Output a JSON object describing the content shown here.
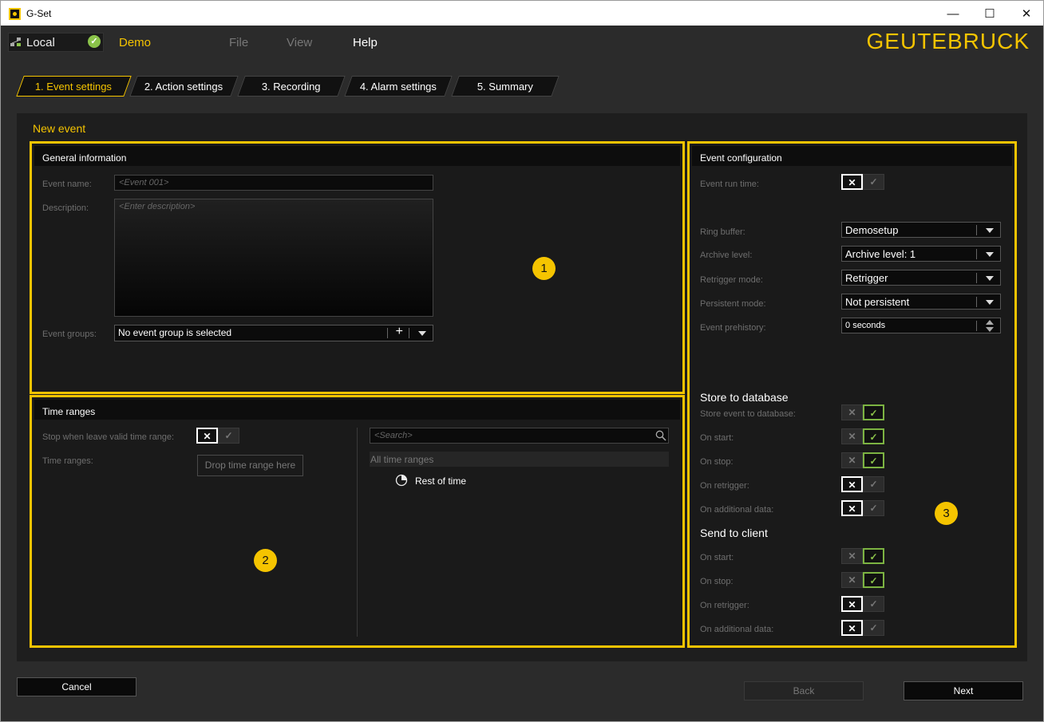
{
  "window": {
    "title": "G-Set",
    "min_icon": "minimize-icon",
    "max_icon": "maximize-icon",
    "close_icon": "close-icon"
  },
  "topbar": {
    "connection": "Local",
    "profile": "Demo",
    "menus": [
      "File",
      "View",
      "Help"
    ],
    "logo": "GEUTEBRUCK"
  },
  "wizard_tabs": [
    "1. Event settings",
    "2. Action settings",
    "3. Recording",
    "4. Alarm settings",
    "5. Summary"
  ],
  "page_title": "New event",
  "general": {
    "header": "General information",
    "event_name_label": "Event name:",
    "event_name_placeholder": "<Event 001>",
    "description_label": "Description:",
    "description_placeholder": "<Enter description>",
    "event_groups_label": "Event groups:",
    "event_groups_value": "No event group is selected"
  },
  "time_ranges": {
    "header": "Time ranges",
    "stop_label": "Stop when leave valid time range:",
    "ranges_label": "Time ranges:",
    "drop_text": "Drop time range here",
    "search_placeholder": "<Search>",
    "list_header": "All time ranges",
    "list_item": "Rest of time"
  },
  "event_config": {
    "header": "Event configuration",
    "run_time_label": "Event run time:",
    "ring_buffer_label": "Ring buffer:",
    "ring_buffer_value": "Demosetup",
    "archive_level_label": "Archive level:",
    "archive_level_value": "Archive level: 1",
    "retrigger_mode_label": "Retrigger mode:",
    "retrigger_mode_value": "Retrigger",
    "persistent_mode_label": "Persistent mode:",
    "persistent_mode_value": "Not persistent",
    "prehistory_label": "Event prehistory:",
    "prehistory_value": "0",
    "prehistory_unit": "seconds",
    "store_db_title": "Store to database",
    "store_db_items": [
      {
        "label": "Store event to database:",
        "state": "on"
      },
      {
        "label": "On start:",
        "state": "on"
      },
      {
        "label": "On stop:",
        "state": "on"
      },
      {
        "label": "On retrigger:",
        "state": "off"
      },
      {
        "label": "On additional data:",
        "state": "off"
      }
    ],
    "send_client_title": "Send to client",
    "send_client_items": [
      {
        "label": "On start:",
        "state": "on"
      },
      {
        "label": "On stop:",
        "state": "on"
      },
      {
        "label": "On retrigger:",
        "state": "off"
      },
      {
        "label": "On additional data:",
        "state": "off"
      }
    ]
  },
  "badges": [
    "1",
    "2",
    "3"
  ],
  "toggle_symbols": {
    "x": "✕",
    "check": "✓"
  },
  "buttons": {
    "cancel": "Cancel",
    "back": "Back",
    "next": "Next"
  },
  "colors": {
    "accent": "#f5c400",
    "on": "#8bc34a",
    "background": "#282828"
  }
}
